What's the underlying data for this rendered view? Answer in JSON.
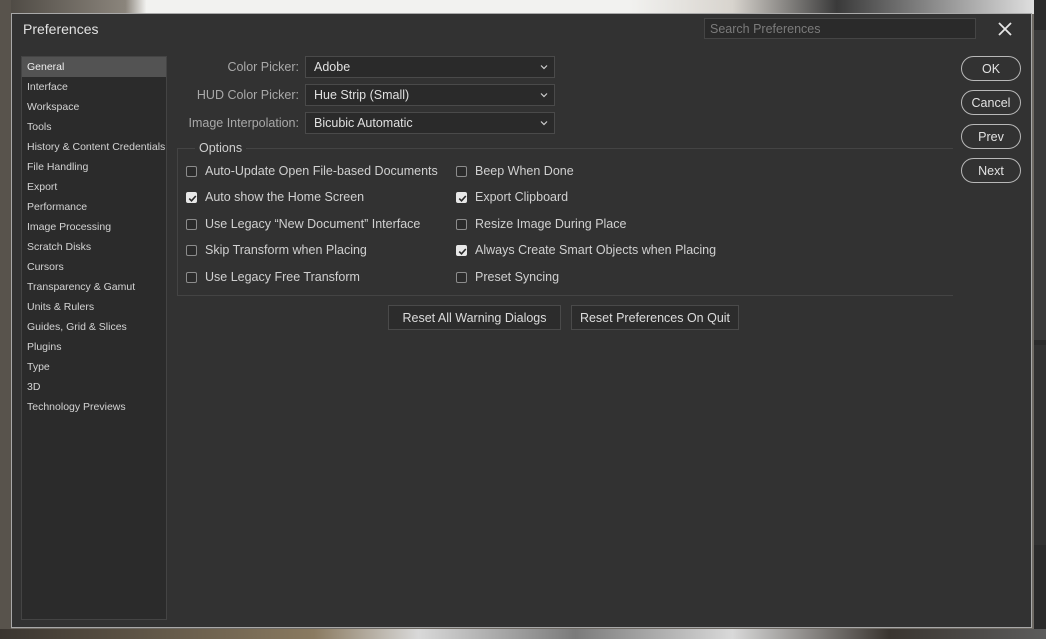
{
  "dialog": {
    "title": "Preferences",
    "search_placeholder": "Search Preferences"
  },
  "sidebar": {
    "items": [
      {
        "label": "General",
        "selected": true
      },
      {
        "label": "Interface"
      },
      {
        "label": "Workspace"
      },
      {
        "label": "Tools"
      },
      {
        "label": "History & Content Credentials"
      },
      {
        "label": "File Handling"
      },
      {
        "label": "Export"
      },
      {
        "label": "Performance"
      },
      {
        "label": "Image Processing"
      },
      {
        "label": "Scratch Disks"
      },
      {
        "label": "Cursors"
      },
      {
        "label": "Transparency & Gamut"
      },
      {
        "label": "Units & Rulers"
      },
      {
        "label": "Guides, Grid & Slices"
      },
      {
        "label": "Plugins"
      },
      {
        "label": "Type"
      },
      {
        "label": "3D"
      },
      {
        "label": "Technology Previews"
      }
    ]
  },
  "fields": {
    "color_picker": {
      "label": "Color Picker:",
      "value": "Adobe"
    },
    "hud_color_picker": {
      "label": "HUD Color Picker:",
      "value": "Hue Strip (Small)"
    },
    "image_interpolation": {
      "label": "Image Interpolation:",
      "value": "Bicubic Automatic"
    }
  },
  "options": {
    "legend": "Options",
    "left": [
      {
        "label": "Auto-Update Open File-based Documents",
        "checked": false
      },
      {
        "label": "Auto show the Home Screen",
        "checked": true
      },
      {
        "label": "Use Legacy “New Document” Interface",
        "checked": false
      },
      {
        "label": "Skip Transform when Placing",
        "checked": false
      },
      {
        "label": "Use Legacy Free Transform",
        "checked": false
      }
    ],
    "right": [
      {
        "label": "Beep When Done",
        "checked": false
      },
      {
        "label": "Export Clipboard",
        "checked": true
      },
      {
        "label": "Resize Image During Place",
        "checked": false
      },
      {
        "label": "Always Create Smart Objects when Placing",
        "checked": true
      },
      {
        "label": "Preset Syncing",
        "checked": false
      }
    ]
  },
  "buttons": {
    "reset_warnings": "Reset All Warning Dialogs",
    "reset_prefs": "Reset Preferences On Quit",
    "ok": "OK",
    "cancel": "Cancel",
    "prev": "Prev",
    "next": "Next"
  },
  "icons": {
    "close": "close-icon",
    "dropdown": "chevron-down-icon",
    "check": "checkmark-icon"
  },
  "colors": {
    "dialog_bg": "#323232",
    "selected_item": "#535353",
    "text": "#cfcfcf"
  }
}
